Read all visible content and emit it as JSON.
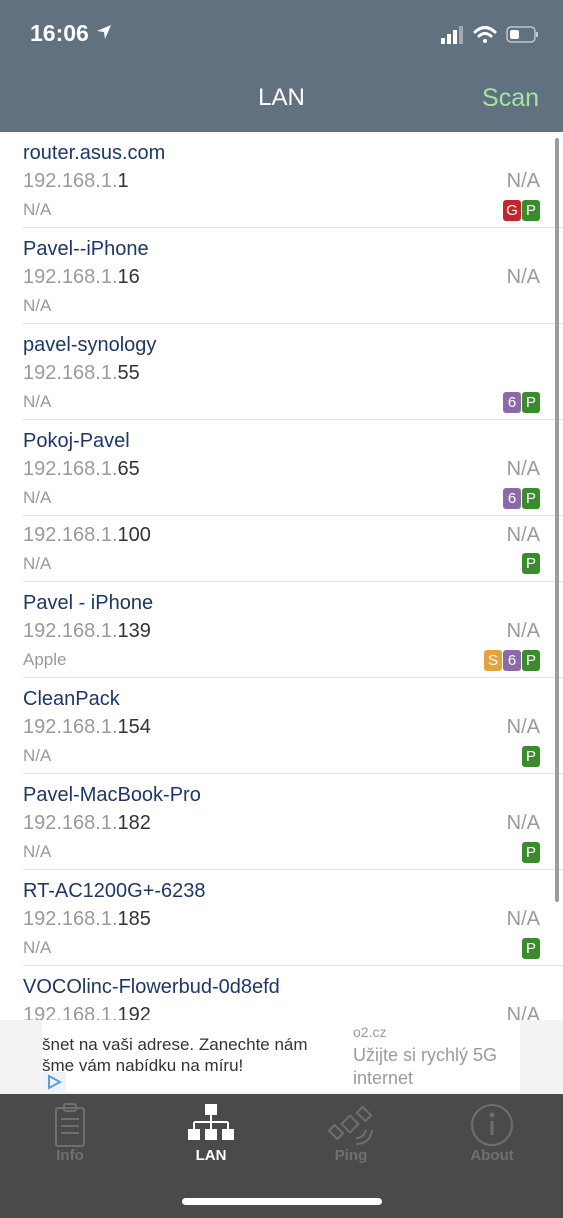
{
  "status": {
    "time": "16:06"
  },
  "nav": {
    "title": "LAN",
    "scan_label": "Scan"
  },
  "devices": [
    {
      "host": "router.asus.com",
      "ip_prefix": "192.168.1.",
      "ip_suffix": "1",
      "right": "N/A",
      "vendor": "N/A",
      "badges": [
        "G",
        "P"
      ]
    },
    {
      "host": "Pavel--iPhone",
      "ip_prefix": "192.168.1.",
      "ip_suffix": "16",
      "right": "N/A",
      "vendor": "N/A",
      "badges": []
    },
    {
      "host": "pavel-synology",
      "ip_prefix": "192.168.1.",
      "ip_suffix": "55",
      "right": "",
      "vendor": "N/A",
      "badges": [
        "6",
        "P"
      ]
    },
    {
      "host": "Pokoj-Pavel",
      "ip_prefix": "192.168.1.",
      "ip_suffix": "65",
      "right": "N/A",
      "vendor": "N/A",
      "badges": [
        "6",
        "P"
      ]
    },
    {
      "host": "",
      "ip_prefix": "192.168.1.",
      "ip_suffix": "100",
      "right": "N/A",
      "vendor": "N/A",
      "badges": [
        "P"
      ]
    },
    {
      "host": "Pavel - iPhone",
      "ip_prefix": "192.168.1.",
      "ip_suffix": "139",
      "right": "N/A",
      "vendor": "Apple",
      "badges": [
        "S",
        "6",
        "P"
      ]
    },
    {
      "host": "CleanPack",
      "ip_prefix": "192.168.1.",
      "ip_suffix": "154",
      "right": "N/A",
      "vendor": "N/A",
      "badges": [
        "P"
      ]
    },
    {
      "host": "Pavel-MacBook-Pro",
      "ip_prefix": "192.168.1.",
      "ip_suffix": "182",
      "right": "N/A",
      "vendor": "N/A",
      "badges": [
        "P"
      ]
    },
    {
      "host": "RT-AC1200G+-6238",
      "ip_prefix": "192.168.1.",
      "ip_suffix": "185",
      "right": "N/A",
      "vendor": "N/A",
      "badges": [
        "P"
      ]
    },
    {
      "host": "VOCOlinc-Flowerbud-0d8efd",
      "ip_prefix": "192.168.1.",
      "ip_suffix": "192",
      "right": "N/A",
      "vendor": "",
      "badges": []
    }
  ],
  "ad": {
    "text_line1": "šnet na vaši adrese. Zanechte nám",
    "text_line2": "šme vám nabídku na míru!",
    "domain": "o2.cz",
    "cta_line1": "Užijte si rychlý 5G",
    "cta_line2": "internet"
  },
  "tabs": [
    {
      "label": "Info",
      "icon": "clipboard-icon"
    },
    {
      "label": "LAN",
      "icon": "network-icon"
    },
    {
      "label": "Ping",
      "icon": "satellite-icon"
    },
    {
      "label": "About",
      "icon": "info-circle-icon"
    }
  ],
  "colors": {
    "nav_bg": "#627180",
    "scan": "#a6e3a1",
    "host": "#1e3766",
    "tab_bg": "#4a4a4a"
  }
}
